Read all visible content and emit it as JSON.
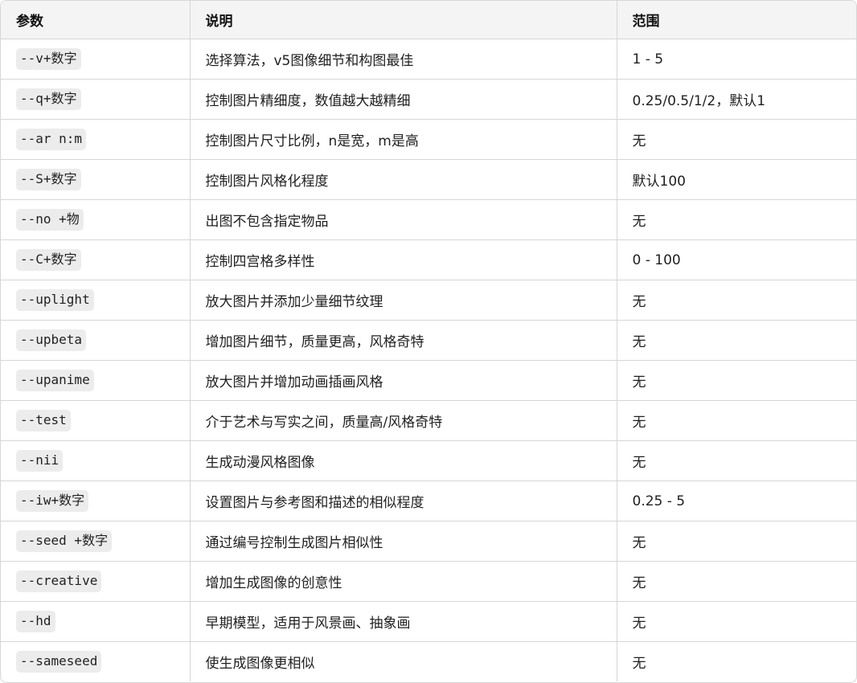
{
  "table": {
    "headers": [
      "参数",
      "说明",
      "范围"
    ],
    "rows": [
      [
        "--v+数字",
        "选择算法，v5图像细节和构图最佳",
        "1 - 5"
      ],
      [
        "--q+数字",
        "控制图片精细度，数值越大越精细",
        "0.25/0.5/1/2，默认1"
      ],
      [
        "--ar n:m",
        "控制图片尺寸比例，n是宽，m是高",
        "无"
      ],
      [
        "--S+数字",
        "控制图片风格化程度",
        "默认100"
      ],
      [
        "--no +物",
        "出图不包含指定物品",
        "无"
      ],
      [
        "--C+数字",
        "控制四宫格多样性",
        "0 - 100"
      ],
      [
        "--uplight",
        "放大图片并添加少量细节纹理",
        "无"
      ],
      [
        "--upbeta",
        "增加图片细节，质量更高，风格奇特",
        "无"
      ],
      [
        "--upanime",
        "放大图片并增加动画插画风格",
        "无"
      ],
      [
        "--test",
        "介于艺术与写实之间，质量高/风格奇特",
        "无"
      ],
      [
        "--nii",
        "生成动漫风格图像",
        "无"
      ],
      [
        "--iw+数字",
        "设置图片与参考图和描述的相似程度",
        "0.25 - 5"
      ],
      [
        "--seed +数字",
        "通过编号控制生成图片相似性",
        "无"
      ],
      [
        "--creative",
        "增加生成图像的创意性",
        "无"
      ],
      [
        "--hd",
        "早期模型，适用于风景画、抽象画",
        "无"
      ],
      [
        "--sameseed",
        "使生成图像更相似",
        "无"
      ]
    ]
  }
}
